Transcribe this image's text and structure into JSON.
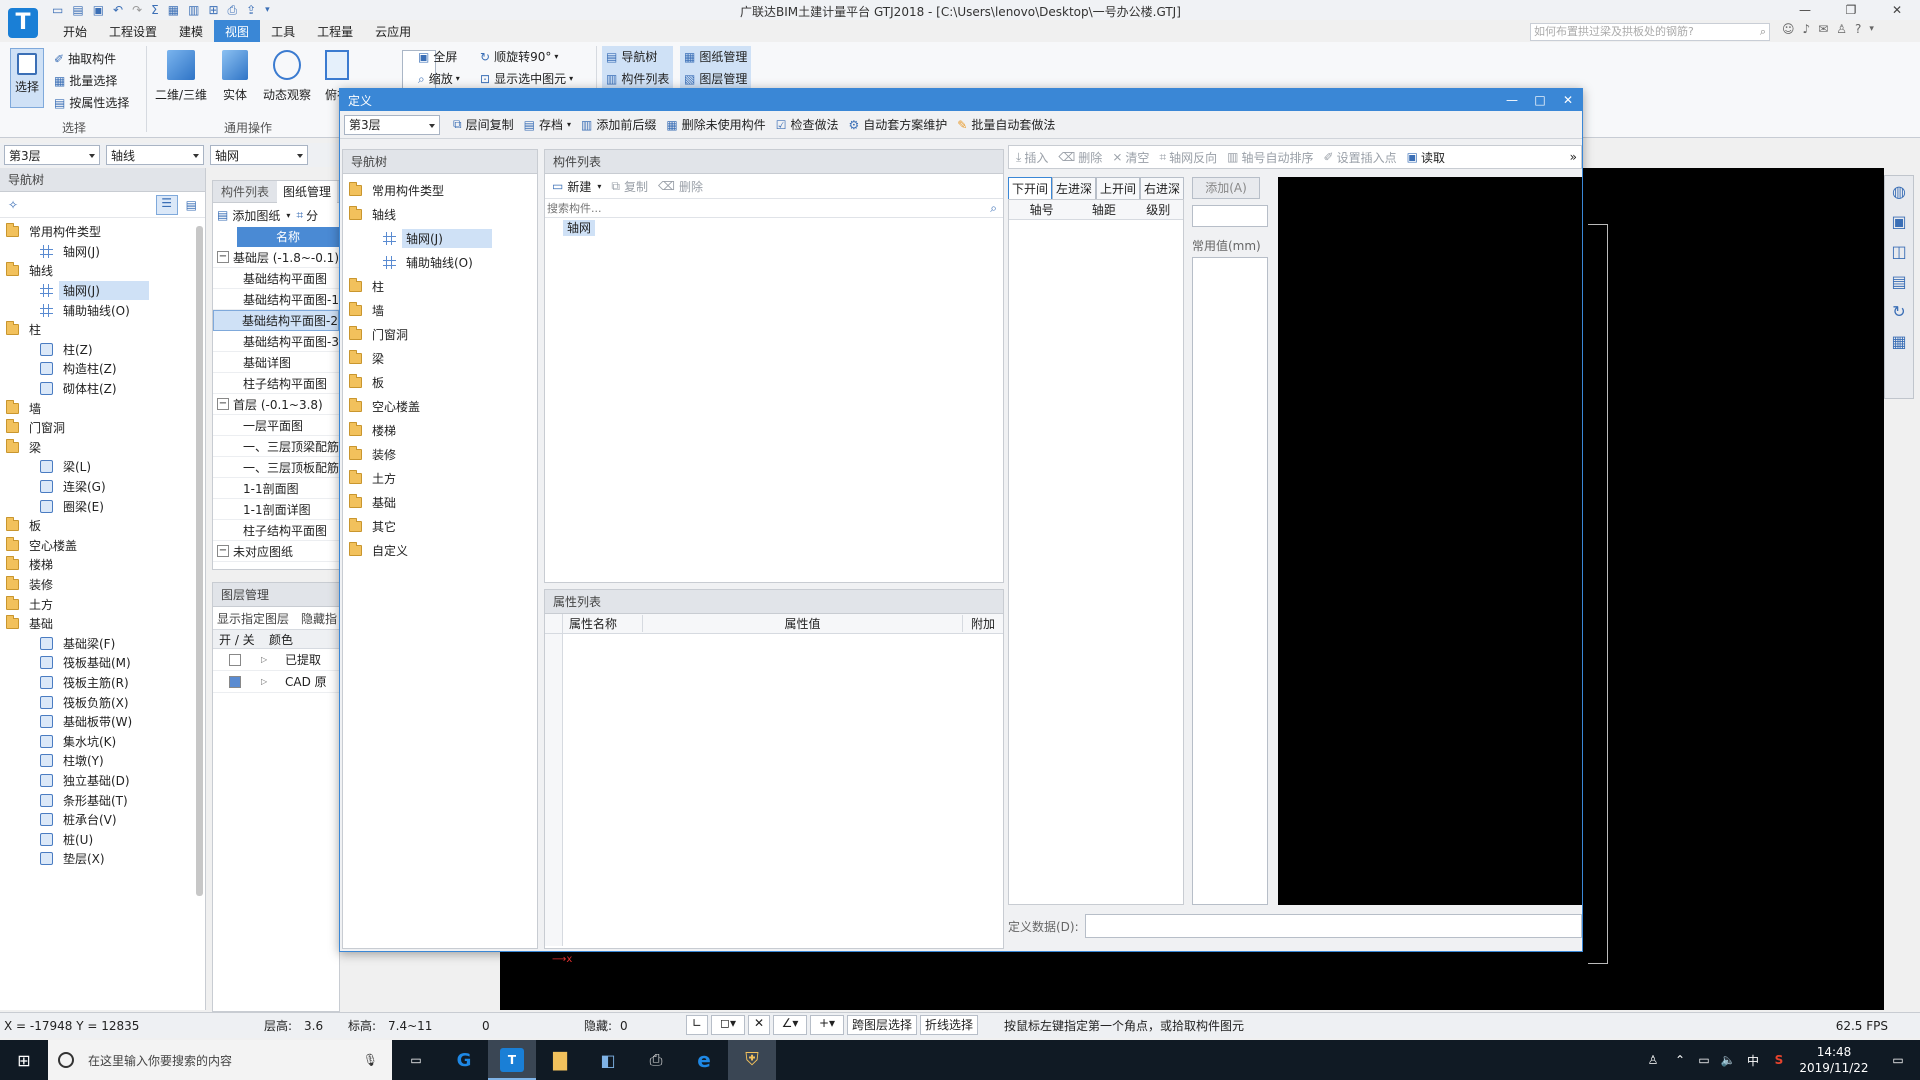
{
  "app": {
    "title": "广联达BIM土建计量平台 GTJ2018 - [C:\\Users\\lenovo\\Desktop\\一号办公楼.GTJ]",
    "search_placeholder": "如何布置拱过梁及拱板处的钢筋?",
    "logo_letter": "T"
  },
  "menu": [
    "开始",
    "工程设置",
    "建模",
    "视图",
    "工具",
    "工程量",
    "云应用"
  ],
  "ribbon": {
    "select_group": {
      "big": "选择",
      "items": [
        "抽取构件",
        "批量选择",
        "按属性选择"
      ],
      "label": "选择"
    },
    "common_group": {
      "items": [
        "二维/三维",
        "实体",
        "动态观察",
        "俯视"
      ],
      "label": "通用操作"
    },
    "view_items": [
      "全屏",
      "缩放",
      "顺旋转90°",
      "显示选中图元"
    ],
    "panel_items": [
      "导航树",
      "构件列表",
      "图纸管理",
      "图层管理"
    ]
  },
  "toolbar_main": {
    "floor": "第3层",
    "category": "轴线",
    "type": "轴网"
  },
  "nav": {
    "title": "导航树",
    "tree": [
      {
        "label": "常用构件类型",
        "level": 0,
        "kind": "folder"
      },
      {
        "label": "轴网(J)",
        "level": 1,
        "kind": "grid"
      },
      {
        "label": "轴线",
        "level": 0,
        "kind": "folder"
      },
      {
        "label": "轴网(J)",
        "level": 1,
        "kind": "grid",
        "selected": true
      },
      {
        "label": "辅助轴线(O)",
        "level": 1,
        "kind": "grid"
      },
      {
        "label": "柱",
        "level": 0,
        "kind": "folder"
      },
      {
        "label": "柱(Z)",
        "level": 1,
        "kind": "item"
      },
      {
        "label": "构造柱(Z)",
        "level": 1,
        "kind": "item"
      },
      {
        "label": "砌体柱(Z)",
        "level": 1,
        "kind": "item"
      },
      {
        "label": "墙",
        "level": 0,
        "kind": "folder"
      },
      {
        "label": "门窗洞",
        "level": 0,
        "kind": "folder"
      },
      {
        "label": "梁",
        "level": 0,
        "kind": "folder"
      },
      {
        "label": "梁(L)",
        "level": 1,
        "kind": "item"
      },
      {
        "label": "连梁(G)",
        "level": 1,
        "kind": "item"
      },
      {
        "label": "圈梁(E)",
        "level": 1,
        "kind": "item"
      },
      {
        "label": "板",
        "level": 0,
        "kind": "folder"
      },
      {
        "label": "空心楼盖",
        "level": 0,
        "kind": "folder"
      },
      {
        "label": "楼梯",
        "level": 0,
        "kind": "folder"
      },
      {
        "label": "装修",
        "level": 0,
        "kind": "folder"
      },
      {
        "label": "土方",
        "level": 0,
        "kind": "folder"
      },
      {
        "label": "基础",
        "level": 0,
        "kind": "folder"
      },
      {
        "label": "基础梁(F)",
        "level": 1,
        "kind": "item"
      },
      {
        "label": "筏板基础(M)",
        "level": 1,
        "kind": "item"
      },
      {
        "label": "筏板主筋(R)",
        "level": 1,
        "kind": "item"
      },
      {
        "label": "筏板负筋(X)",
        "level": 1,
        "kind": "item"
      },
      {
        "label": "基础板带(W)",
        "level": 1,
        "kind": "item"
      },
      {
        "label": "集水坑(K)",
        "level": 1,
        "kind": "item"
      },
      {
        "label": "柱墩(Y)",
        "level": 1,
        "kind": "item"
      },
      {
        "label": "独立基础(D)",
        "level": 1,
        "kind": "item"
      },
      {
        "label": "条形基础(T)",
        "level": 1,
        "kind": "item"
      },
      {
        "label": "桩承台(V)",
        "level": 1,
        "kind": "item"
      },
      {
        "label": "桩(U)",
        "level": 1,
        "kind": "item"
      },
      {
        "label": "垫层(X)",
        "level": 1,
        "kind": "item"
      }
    ]
  },
  "drawing_panel": {
    "tabs": [
      "构件列表",
      "图纸管理"
    ],
    "add_drawing": "添加图纸",
    "split": "分",
    "col_name": "名称",
    "rows": [
      {
        "label": "基础层 (-1.8~-0.1)",
        "group": true
      },
      {
        "label": "基础结构平面图"
      },
      {
        "label": "基础结构平面图-1"
      },
      {
        "label": "基础结构平面图-2",
        "selected": true
      },
      {
        "label": "基础结构平面图-3"
      },
      {
        "label": "基础详图"
      },
      {
        "label": "柱子结构平面图"
      },
      {
        "label": "首层 (-0.1~3.8)",
        "group": true
      },
      {
        "label": "一层平面图"
      },
      {
        "label": "一、三层顶梁配筋"
      },
      {
        "label": "一、三层顶板配筋"
      },
      {
        "label": "1-1剖面图"
      },
      {
        "label": "1-1剖面详图"
      },
      {
        "label": "柱子结构平面图"
      },
      {
        "label": "未对应图纸",
        "group": true
      }
    ]
  },
  "layer_panel": {
    "title": "图层管理",
    "show": "显示指定图层",
    "hide": "隐藏指",
    "col_onoff": "开 / 关",
    "col_color": "颜色",
    "rows": [
      "已提取",
      "CAD 原"
    ]
  },
  "dialog": {
    "title": "定义",
    "toolbar": {
      "floor": "第3层",
      "items": [
        "层间复制",
        "存档",
        "添加前后缀",
        "删除未使用构件",
        "检查做法",
        "自动套方案维护",
        "批量自动套做法"
      ]
    },
    "nav_title": "导航树",
    "tree": [
      {
        "label": "常用构件类型",
        "level": 0,
        "kind": "folder"
      },
      {
        "label": "轴线",
        "level": 0,
        "kind": "folder"
      },
      {
        "label": "轴网(J)",
        "level": 1,
        "kind": "grid",
        "selected": true
      },
      {
        "label": "辅助轴线(O)",
        "level": 1,
        "kind": "grid"
      },
      {
        "label": "柱",
        "level": 0,
        "kind": "folder"
      },
      {
        "label": "墙",
        "level": 0,
        "kind": "folder"
      },
      {
        "label": "门窗洞",
        "level": 0,
        "kind": "folder"
      },
      {
        "label": "梁",
        "level": 0,
        "kind": "folder"
      },
      {
        "label": "板",
        "level": 0,
        "kind": "folder"
      },
      {
        "label": "空心楼盖",
        "level": 0,
        "kind": "folder"
      },
      {
        "label": "楼梯",
        "level": 0,
        "kind": "folder"
      },
      {
        "label": "装修",
        "level": 0,
        "kind": "folder"
      },
      {
        "label": "土方",
        "level": 0,
        "kind": "folder"
      },
      {
        "label": "基础",
        "level": 0,
        "kind": "folder"
      },
      {
        "label": "其它",
        "level": 0,
        "kind": "folder"
      },
      {
        "label": "自定义",
        "level": 0,
        "kind": "folder"
      }
    ],
    "comp_list": {
      "title": "构件列表",
      "new": "新建",
      "copy": "复制",
      "delete": "删除",
      "search_placeholder": "搜索构件...",
      "items": [
        "轴网"
      ]
    },
    "prop_list": {
      "title": "属性列表",
      "cols": [
        "属性名称",
        "属性值",
        "附加"
      ]
    },
    "grid_toolbar": [
      "插入",
      "删除",
      "清空",
      "轴网反向",
      "轴号自动排序",
      "设置插入点",
      "读取"
    ],
    "tabs": [
      "下开间",
      "左进深",
      "上开间",
      "右进深"
    ],
    "add_btn": "添加(A)",
    "grid_cols": [
      "轴号",
      "轴距",
      "级别"
    ],
    "common_value": "常用值(mm)",
    "def_data": "定义数据(D):"
  },
  "status": {
    "coords": "X = -17948 Y = 12835",
    "floor_height_label": "层高:",
    "floor_height": "3.6",
    "elev_label": "标高:",
    "elev": "7.4~11",
    "zero": "0",
    "hidden_label": "隐藏:",
    "hidden": "0",
    "cross_floor": "跨图层选择",
    "polyline": "折线选择",
    "hint": "按鼠标左键指定第一个角点，或拾取构件图元",
    "fps": "62.5 FPS"
  },
  "taskbar": {
    "search": "在这里输入你要搜索的内容",
    "ime": "中",
    "time": "14:48",
    "date": "2019/11/22"
  }
}
